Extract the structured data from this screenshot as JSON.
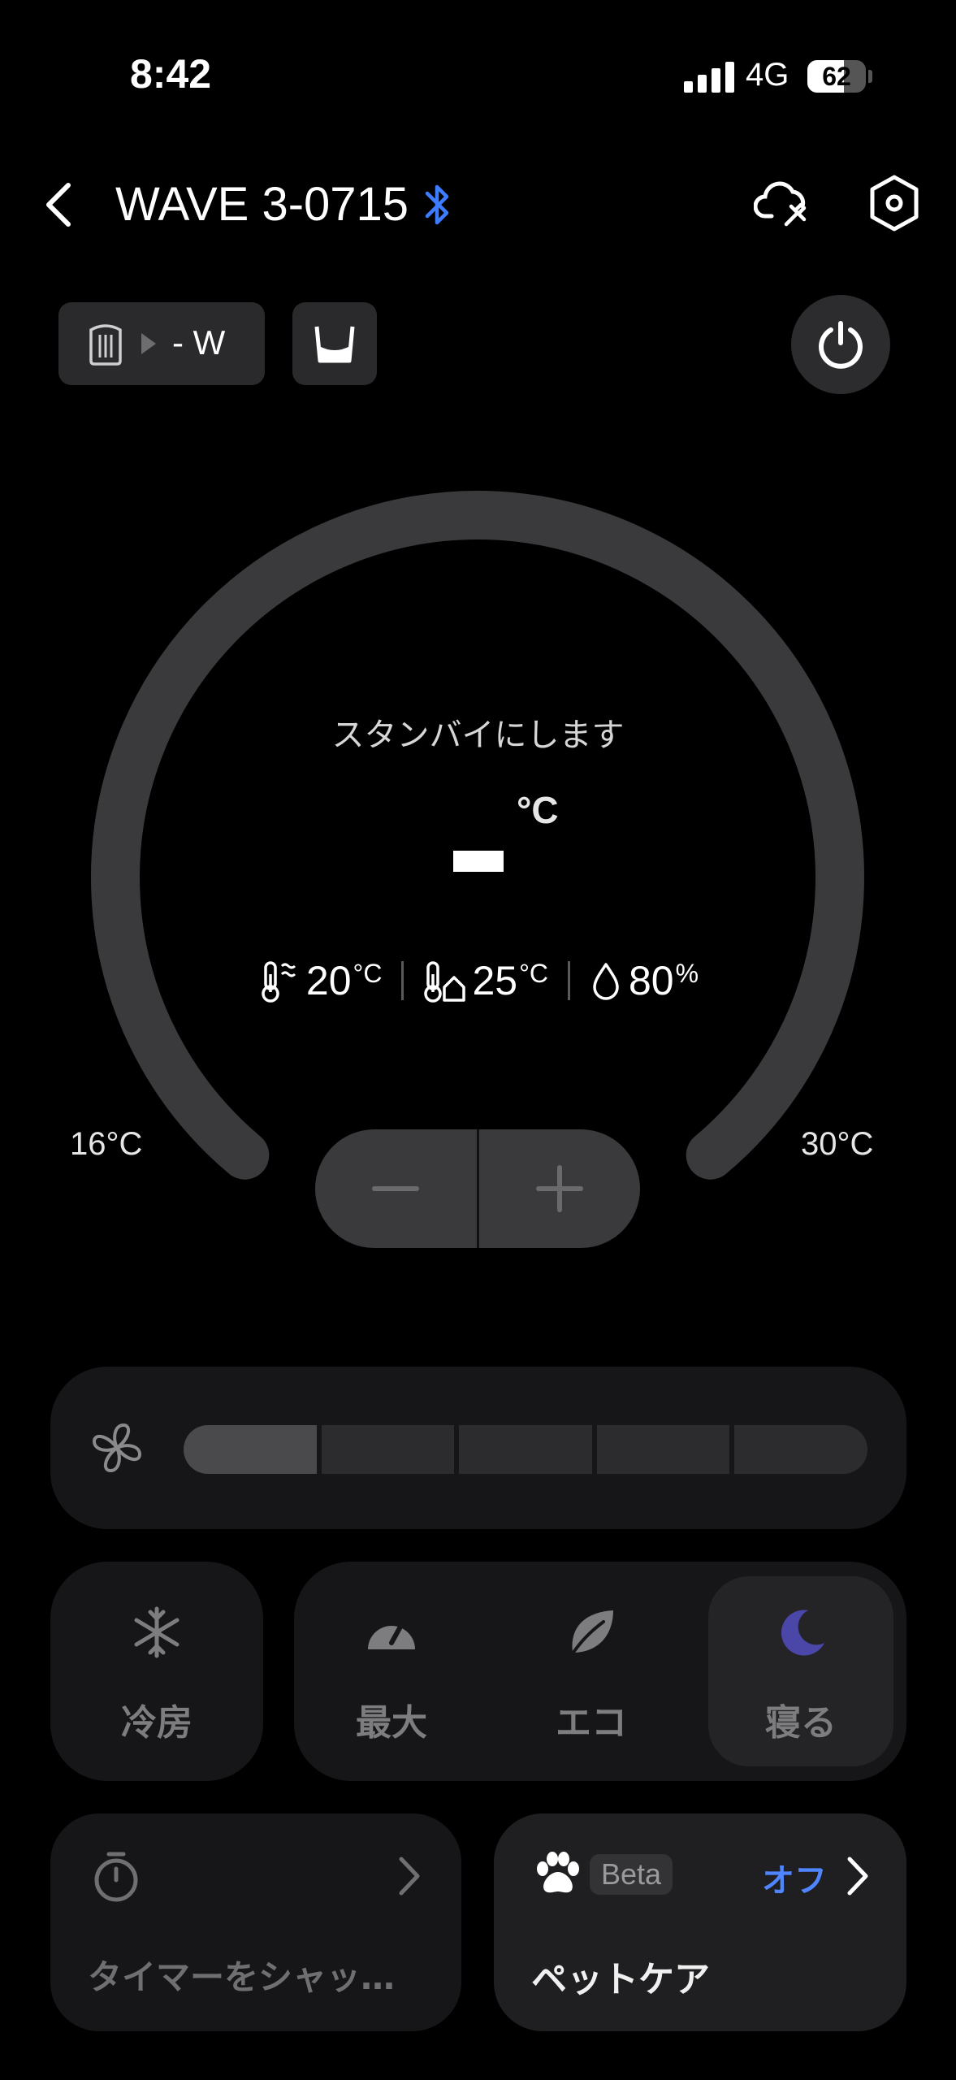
{
  "status_bar": {
    "time": "8:42",
    "network": "4G",
    "battery": "62",
    "battery_level": 0.62
  },
  "header": {
    "device_name": "WAVE 3-0715"
  },
  "chips": {
    "power_label": "- W"
  },
  "dial": {
    "status": "スタンバイにします",
    "unit": "°C",
    "range_min": "16°C",
    "range_max": "30°C",
    "colors": {
      "track": "#3a3a3c"
    }
  },
  "readings": [
    {
      "value": "20",
      "unit": "°C",
      "icon": "outdoor-thermometer-icon"
    },
    {
      "value": "25",
      "unit": "°C",
      "icon": "indoor-thermometer-icon"
    },
    {
      "value": "80",
      "unit": "%",
      "icon": "humidity-drop-icon"
    }
  ],
  "fan": {
    "levels": 5,
    "current": 1
  },
  "modes": {
    "cool": "冷房",
    "max": "最大",
    "eco": "エコ",
    "sleep": "寝る",
    "selected": "sleep"
  },
  "timer": {
    "label": "タイマーをシャッ…"
  },
  "pet_care": {
    "badge": "Beta",
    "state": "オフ",
    "label": "ペットケア"
  },
  "colors": {
    "accent_blue": "#4f86ff",
    "bluetooth": "#3d7bff",
    "moon": "#4b47a8"
  }
}
